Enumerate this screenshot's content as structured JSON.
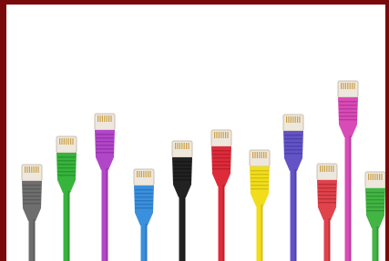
{
  "photo": {
    "frame_color": "#7a0a0a",
    "background": "#ffffff",
    "cables": [
      {
        "name": "gray",
        "color": "#6e6e6e",
        "dark": "#4a4a4a"
      },
      {
        "name": "green",
        "color": "#36b43c",
        "dark": "#1f7e25"
      },
      {
        "name": "purple",
        "color": "#b246c9",
        "dark": "#7d2692"
      },
      {
        "name": "blue",
        "color": "#3a90dc",
        "dark": "#1f62a6"
      },
      {
        "name": "black",
        "color": "#222222",
        "dark": "#0d0d0d"
      },
      {
        "name": "red",
        "color": "#de2b3a",
        "dark": "#9c1622"
      },
      {
        "name": "yellow",
        "color": "#f1dd1a",
        "dark": "#b9a50c"
      },
      {
        "name": "violet",
        "color": "#6353c7",
        "dark": "#3d3390"
      },
      {
        "name": "red-2",
        "color": "#e0434c",
        "dark": "#9f1e27"
      },
      {
        "name": "pink",
        "color": "#d94bb7",
        "dark": "#9c2883"
      },
      {
        "name": "green-2",
        "color": "#42b544",
        "dark": "#257c27"
      }
    ]
  }
}
